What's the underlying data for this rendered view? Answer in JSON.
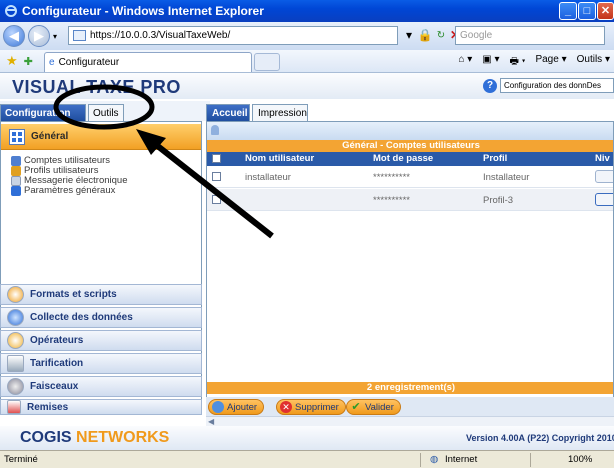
{
  "browser": {
    "window_title": "Configurateur - Windows Internet Explorer",
    "address": "https://10.0.0.3/VisualTaxeWeb/",
    "search_placeholder": "Google",
    "tab_title": "Configurateur",
    "cmd_page": "Page",
    "cmd_tools": "Outils"
  },
  "app": {
    "brand": "VISUAL TAXE PRO",
    "config_select": "Configuration des donnDes",
    "left_tabs": [
      "Configuration",
      "Outils"
    ],
    "general_label": "Général",
    "menu_items": [
      "Comptes utilisateurs",
      "Profils utilisateurs",
      "Messagerie électronique",
      "Paramètres généraux"
    ],
    "accordion": [
      "Formats et scripts",
      "Collecte des données",
      "Opérateurs",
      "Tarification",
      "Faisceaux",
      "Remises"
    ],
    "right_tabs": [
      "Accueil",
      "Impression"
    ],
    "table_caption": "Général - Comptes utilisateurs",
    "columns": [
      "Nom utilisateur",
      "Mot de passe",
      "Profil",
      "Niv"
    ],
    "rows": [
      {
        "user": "installateur",
        "password": "**********",
        "profile": "Installateur"
      },
      {
        "user": "",
        "password": "**********",
        "profile": "Profil-3"
      }
    ],
    "records": "2 enregistrement(s)",
    "buttons": [
      "Ajouter",
      "Supprimer",
      "Valider"
    ],
    "footer_brand_a": "COGIS",
    "footer_brand_b": "NETWORKS",
    "version": "Version 4.00A (P22)    Copyright 2010"
  },
  "statusbar": {
    "left": "Terminé",
    "zone": "Internet",
    "zoom": "100%"
  },
  "colors": {
    "accent_orange": "#f3a433",
    "header_blue": "#2a5aa8",
    "brand_blue": "#1f3a7a"
  }
}
